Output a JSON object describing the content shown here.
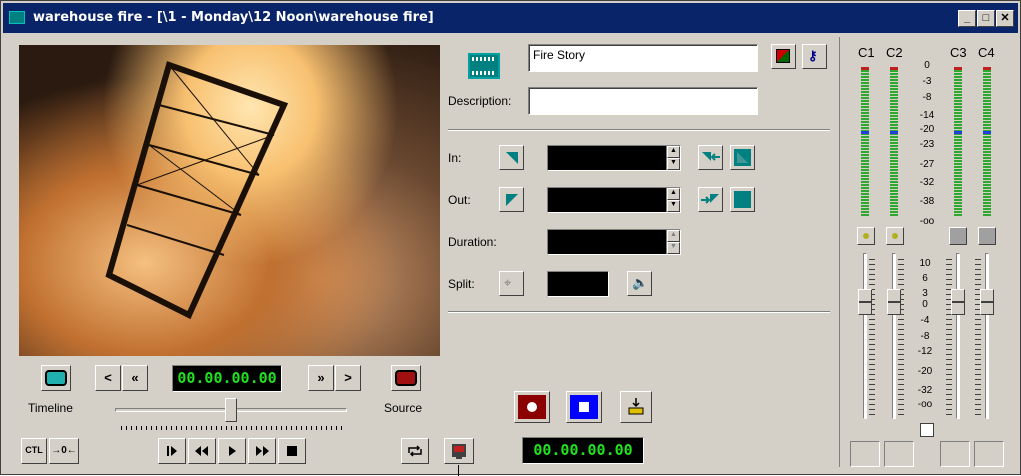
{
  "window": {
    "title": "warehouse fire - [\\1 - Monday\\12 Noon\\warehouse fire]",
    "controls": {
      "minimize": "_",
      "maximize": "□",
      "close": "✕"
    }
  },
  "clip": {
    "name": "Fire Story",
    "description_label": "Description:",
    "description_value": ""
  },
  "marks": {
    "in_label": "In:",
    "out_label": "Out:",
    "duration_label": "Duration:",
    "split_label": "Split:"
  },
  "transport": {
    "timecode": "00.00.00.00",
    "timeline_label": "Timeline",
    "source_label": "Source",
    "prev_label": "<",
    "rewind_label": "«",
    "ffwd_label": "»",
    "next_label": ">",
    "ctl_label": "CTL",
    "zero_label": "→0←"
  },
  "record": {
    "timecode": "00.00.00.00"
  },
  "audio": {
    "channels": [
      "C1",
      "C2",
      "C3",
      "C4"
    ],
    "meter_scale": [
      "0",
      "-3",
      "-8",
      "-14",
      "-20",
      "-23",
      "-27",
      "-32",
      "-38",
      "-oo"
    ],
    "fader_scale": [
      "10",
      "6",
      "3",
      "0",
      "-4",
      "-8",
      "-12",
      "-20",
      "-32",
      "-oo"
    ]
  },
  "colors": {
    "title_bar": "#0a246a",
    "timecode_green": "#20e020",
    "teal": "#008080",
    "record_red": "#8b0000",
    "stop_blue": "#0000ff"
  }
}
